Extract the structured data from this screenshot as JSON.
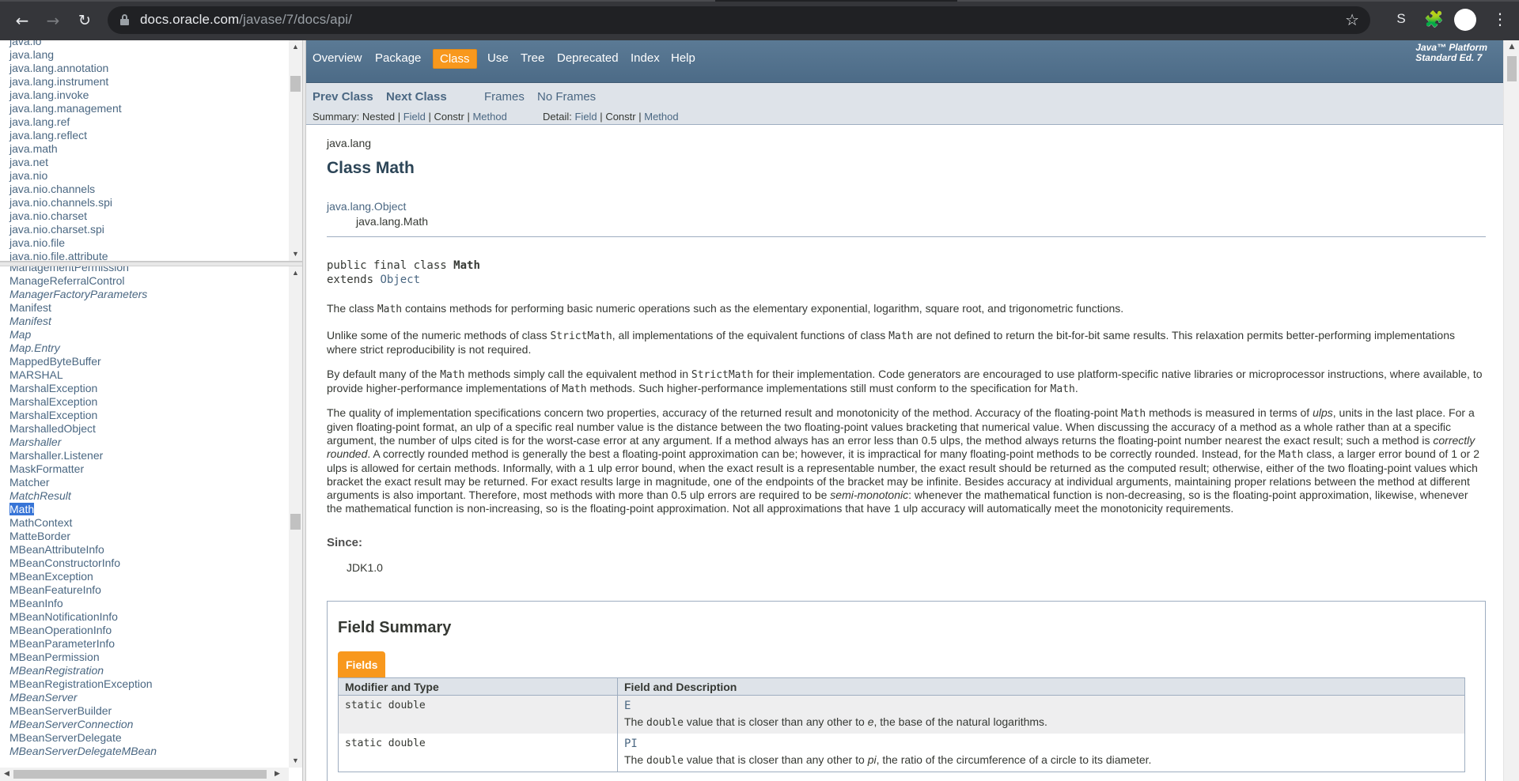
{
  "browser": {
    "url_host": "docs.oracle.com",
    "url_path": "/javase/7/docs/api/",
    "back_icon": "arrow-left",
    "forward_icon": "arrow-right",
    "reload_icon": "reload",
    "bookmark_icon": "star",
    "extension_s_label": "S",
    "extensions_icon": "puzzle",
    "menu_icon": "three-dots"
  },
  "packages_frame": {
    "items": [
      "java.io",
      "java.lang",
      "java.lang.annotation",
      "java.lang.instrument",
      "java.lang.invoke",
      "java.lang.management",
      "java.lang.ref",
      "java.lang.reflect",
      "java.math",
      "java.net",
      "java.nio",
      "java.nio.channels",
      "java.nio.channels.spi",
      "java.nio.charset",
      "java.nio.charset.spi",
      "java.nio.file",
      "java.nio.file.attribute"
    ]
  },
  "classes_frame": {
    "items": [
      {
        "name": "ManagementPermission",
        "italic": false
      },
      {
        "name": "ManageReferralControl",
        "italic": false
      },
      {
        "name": "ManagerFactoryParameters",
        "italic": true
      },
      {
        "name": "Manifest",
        "italic": false
      },
      {
        "name": "Manifest",
        "italic": true
      },
      {
        "name": "Map",
        "italic": true
      },
      {
        "name": "Map.Entry",
        "italic": true
      },
      {
        "name": "MappedByteBuffer",
        "italic": false
      },
      {
        "name": "MARSHAL",
        "italic": false
      },
      {
        "name": "MarshalException",
        "italic": false
      },
      {
        "name": "MarshalException",
        "italic": false
      },
      {
        "name": "MarshalException",
        "italic": false
      },
      {
        "name": "MarshalledObject",
        "italic": false
      },
      {
        "name": "Marshaller",
        "italic": true
      },
      {
        "name": "Marshaller.Listener",
        "italic": false
      },
      {
        "name": "MaskFormatter",
        "italic": false
      },
      {
        "name": "Matcher",
        "italic": false
      },
      {
        "name": "MatchResult",
        "italic": true
      },
      {
        "name": "Math",
        "italic": false,
        "selected": true
      },
      {
        "name": "MathContext",
        "italic": false
      },
      {
        "name": "MatteBorder",
        "italic": false
      },
      {
        "name": "MBeanAttributeInfo",
        "italic": false
      },
      {
        "name": "MBeanConstructorInfo",
        "italic": false
      },
      {
        "name": "MBeanException",
        "italic": false
      },
      {
        "name": "MBeanFeatureInfo",
        "italic": false
      },
      {
        "name": "MBeanInfo",
        "italic": false
      },
      {
        "name": "MBeanNotificationInfo",
        "italic": false
      },
      {
        "name": "MBeanOperationInfo",
        "italic": false
      },
      {
        "name": "MBeanParameterInfo",
        "italic": false
      },
      {
        "name": "MBeanPermission",
        "italic": false
      },
      {
        "name": "MBeanRegistration",
        "italic": true
      },
      {
        "name": "MBeanRegistrationException",
        "italic": false
      },
      {
        "name": "MBeanServer",
        "italic": true
      },
      {
        "name": "MBeanServerBuilder",
        "italic": false
      },
      {
        "name": "MBeanServerConnection",
        "italic": true
      },
      {
        "name": "MBeanServerDelegate",
        "italic": false
      },
      {
        "name": "MBeanServerDelegateMBean",
        "italic": true
      }
    ]
  },
  "topnav": {
    "overview": "Overview",
    "package": "Package",
    "class": "Class",
    "use": "Use",
    "tree": "Tree",
    "deprecated": "Deprecated",
    "index": "Index",
    "help": "Help",
    "platform_line1": "Java™ Platform",
    "platform_line2": "Standard Ed. 7"
  },
  "subnav": {
    "prev_class": "Prev Class",
    "next_class": "Next Class",
    "frames": "Frames",
    "no_frames": "No Frames",
    "summary_label": "Summary:",
    "summary_nested": "Nested",
    "summary_field": "Field",
    "summary_constr": "Constr",
    "summary_method": "Method",
    "detail_label": "Detail:",
    "detail_field": "Field",
    "detail_constr": "Constr",
    "detail_method": "Method",
    "sep": "|"
  },
  "class_doc": {
    "package": "java.lang",
    "title": "Class Math",
    "inherit_parent": "java.lang.Object",
    "inherit_child": "java.lang.Math",
    "decl_line1_prefix": "public final class ",
    "decl_line1_name": "Math",
    "decl_line2_prefix": "extends ",
    "decl_line2_link": "Object",
    "p1": "The class <code>Math</code> contains methods for performing basic numeric operations such as the elementary exponential, logarithm, square root, and trigonometric functions.",
    "p2": "Unlike some of the numeric methods of class <code>StrictMath</code>, all implementations of the equivalent functions of class <code>Math</code> are not defined to return the bit-for-bit same results. This relaxation permits better-performing implementations where strict reproducibility is not required.",
    "p3": "By default many of the <code>Math</code> methods simply call the equivalent method in <code>StrictMath</code> for their implementation. Code generators are encouraged to use platform-specific native libraries or microprocessor instructions, where available, to provide higher-performance implementations of <code>Math</code> methods. Such higher-performance implementations still must conform to the specification for <code>Math</code>.",
    "p4": "The quality of implementation specifications concern two properties, accuracy of the returned result and monotonicity of the method. Accuracy of the floating-point <code>Math</code> methods is measured in terms of <i>ulps</i>, units in the last place. For a given floating-point format, an ulp of a specific real number value is the distance between the two floating-point values bracketing that numerical value. When discussing the accuracy of a method as a whole rather than at a specific argument, the number of ulps cited is for the worst-case error at any argument. If a method always has an error less than 0.5 ulps, the method always returns the floating-point number nearest the exact result; such a method is <i>correctly rounded</i>. A correctly rounded method is generally the best a floating-point approximation can be; however, it is impractical for many floating-point methods to be correctly rounded. Instead, for the <code>Math</code> class, a larger error bound of 1 or 2 ulps is allowed for certain methods. Informally, with a 1 ulp error bound, when the exact result is a representable number, the exact result should be returned as the computed result; otherwise, either of the two floating-point values which bracket the exact result may be returned. For exact results large in magnitude, one of the endpoints of the bracket may be infinite. Besides accuracy at individual arguments, maintaining proper relations between the method at different arguments is also important. Therefore, most methods with more than 0.5 ulp errors are required to be <i>semi-monotonic</i>: whenever the mathematical function is non-decreasing, so is the floating-point approximation, likewise, whenever the mathematical function is non-increasing, so is the floating-point approximation. Not all approximations that have 1 ulp accuracy will automatically meet the monotonicity requirements.",
    "since_heading": "Since:",
    "since_value": "JDK1.0"
  },
  "field_summary": {
    "title": "Field Summary",
    "tab_label": "Fields",
    "col1": "Modifier and Type",
    "col2": "Field and Description",
    "rows": [
      {
        "type": "static double",
        "name": "E",
        "desc": "The <code>double</code> value that is closer than any other to <i>e</i>, the base of the natural logarithms."
      },
      {
        "type": "static double",
        "name": "PI",
        "desc": "The <code>double</code> value that is closer than any other to <i>pi</i>, the ratio of the circumference of a circle to its diameter."
      }
    ]
  }
}
